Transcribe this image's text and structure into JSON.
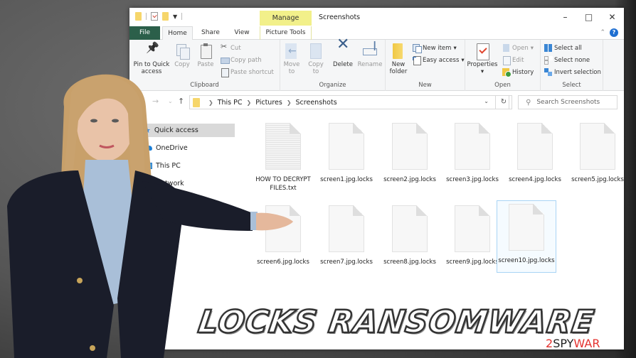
{
  "window": {
    "title": "Screenshots",
    "contextual_tab": "Manage",
    "contextual_group": "Picture Tools",
    "controls": {
      "minimize": "–",
      "maximize": "□",
      "close": "✕"
    },
    "help": "?"
  },
  "tabs": [
    {
      "label": "File"
    },
    {
      "label": "Home"
    },
    {
      "label": "Share"
    },
    {
      "label": "View"
    },
    {
      "label": "Picture Tools"
    }
  ],
  "ribbon": {
    "clipboard": {
      "label": "Clipboard",
      "pin": "Pin to Quick access",
      "copy": "Copy",
      "paste": "Paste",
      "cut": "Cut",
      "copy_path": "Copy path",
      "paste_shortcut": "Paste shortcut"
    },
    "organize": {
      "label": "Organize",
      "move_to": "Move to",
      "copy_to": "Copy to",
      "delete": "Delete",
      "rename": "Rename"
    },
    "new": {
      "label": "New",
      "new_folder": "New folder",
      "new_item": "New item",
      "easy_access": "Easy access"
    },
    "open": {
      "label": "Open",
      "properties": "Properties",
      "open": "Open",
      "edit": "Edit",
      "history": "History"
    },
    "select": {
      "label": "Select",
      "select_all": "Select all",
      "select_none": "Select none",
      "invert_selection": "Invert selection"
    }
  },
  "address": {
    "path": [
      "This PC",
      "Pictures",
      "Screenshots"
    ],
    "search_placeholder": "Search Screenshots"
  },
  "nav_pane": [
    {
      "label": "Quick access",
      "icon": "star-icon",
      "selected": true
    },
    {
      "label": "OneDrive",
      "icon": "cloud-icon",
      "selected": false
    },
    {
      "label": "This PC",
      "icon": "computer-icon",
      "selected": false
    },
    {
      "label": "Network",
      "icon": "network-icon",
      "selected": false
    }
  ],
  "files": [
    {
      "name": "HOW TO DECRYPT FILES.txt",
      "type": "txt"
    },
    {
      "name": "screen1.jpg.locks",
      "type": "locked"
    },
    {
      "name": "screen2.jpg.locks",
      "type": "locked"
    },
    {
      "name": "screen3.jpg.locks",
      "type": "locked"
    },
    {
      "name": "screen4.jpg.locks",
      "type": "locked"
    },
    {
      "name": "screen5.jpg.locks",
      "type": "locked"
    },
    {
      "name": "screen6.jpg.locks",
      "type": "locked"
    },
    {
      "name": "screen7.jpg.locks",
      "type": "locked"
    },
    {
      "name": "screen8.jpg.locks",
      "type": "locked"
    },
    {
      "name": "screen9.jpg.locks",
      "type": "locked"
    },
    {
      "name": "screen10.jpg.locks",
      "type": "locked",
      "selected": true
    }
  ],
  "banner": {
    "text": "LOCKS RANSOMWARE"
  },
  "watermark": {
    "part1": "2",
    "part2": "SPY",
    "part3": "WAR"
  },
  "colors": {
    "file_tab": "#2b5f4a",
    "manage_tab": "#f2f08a",
    "selection": "#a9d4f5",
    "watermark_red": "#e4322f"
  }
}
